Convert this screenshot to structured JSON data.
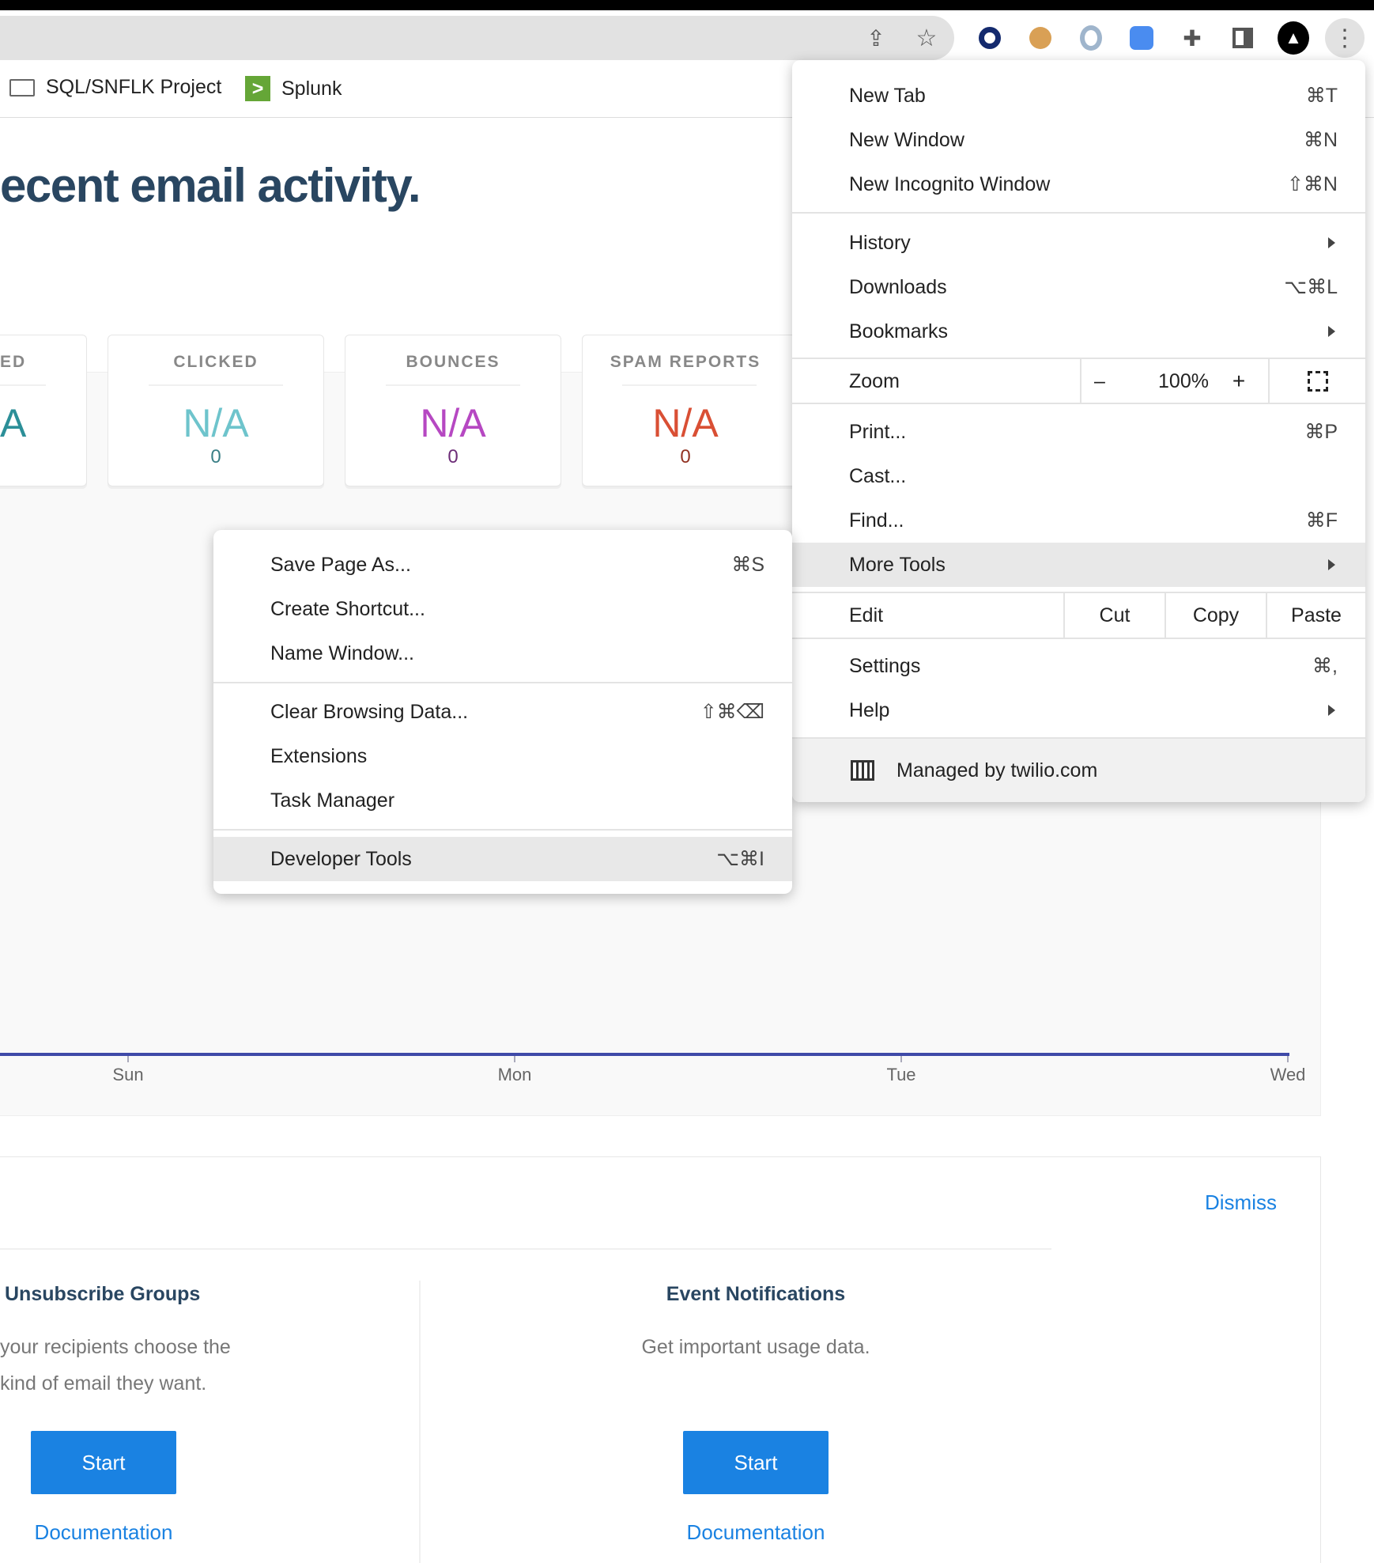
{
  "browser": {
    "toolbar_icons": [
      "share-icon",
      "bookmark-star-icon",
      "extension-o-icon",
      "cookie-extension-icon",
      "extension-ring-icon",
      "zoom-extension-icon",
      "extensions-puzzle-icon",
      "side-panel-icon",
      "profile-rocket-icon",
      "kebab-menu-icon"
    ],
    "bookmarks": [
      {
        "label": "SQL/SNFLK Project",
        "icon": "folder-icon"
      },
      {
        "label": "Splunk",
        "icon": "splunk-icon"
      }
    ]
  },
  "page": {
    "title": "ecent email activity.",
    "cards": [
      {
        "label": "ED",
        "value": "A",
        "count": "",
        "color": "#2c8f98"
      },
      {
        "label": "CLICKED",
        "value": "N/A",
        "count": "0",
        "color": "#6ec4cc",
        "count_color": "#3a7f86"
      },
      {
        "label": "BOUNCES",
        "value": "N/A",
        "count": "0",
        "color": "#b648c2",
        "count_color": "#6d2d78"
      },
      {
        "label": "SPAM REPORTS",
        "value": "N/A",
        "count": "0",
        "color": "#d94f34",
        "count_color": "#923222"
      }
    ],
    "chart": {
      "x_labels": [
        "Sun",
        "Mon",
        "Tue",
        "Wed"
      ],
      "line_color": "#3f4aa8"
    },
    "bottom": {
      "dismiss": "Dismiss",
      "sections": [
        {
          "title": "Unsubscribe Groups",
          "desc1": "your recipients choose the",
          "desc2": "kind of email they want.",
          "button": "Start",
          "link": "Documentation"
        },
        {
          "title": "Event Notifications",
          "desc1": "Get important usage data.",
          "button": "Start",
          "link": "Documentation"
        }
      ]
    }
  },
  "menu": {
    "new_tab": {
      "label": "New Tab",
      "shortcut": "⌘T"
    },
    "new_window": {
      "label": "New Window",
      "shortcut": "⌘N"
    },
    "incognito": {
      "label": "New Incognito Window",
      "shortcut": "⇧⌘N"
    },
    "history": {
      "label": "History"
    },
    "downloads": {
      "label": "Downloads",
      "shortcut": "⌥⌘L"
    },
    "bookmarks": {
      "label": "Bookmarks"
    },
    "zoom": {
      "label": "Zoom",
      "minus": "–",
      "value": "100%",
      "plus": "+"
    },
    "print": {
      "label": "Print...",
      "shortcut": "⌘P"
    },
    "cast": {
      "label": "Cast..."
    },
    "find": {
      "label": "Find...",
      "shortcut": "⌘F"
    },
    "more_tools": {
      "label": "More Tools"
    },
    "edit": {
      "label": "Edit",
      "cut": "Cut",
      "copy": "Copy",
      "paste": "Paste"
    },
    "settings": {
      "label": "Settings",
      "shortcut": "⌘,"
    },
    "help": {
      "label": "Help"
    },
    "managed": {
      "label": "Managed by twilio.com"
    }
  },
  "submenu": {
    "save_page": {
      "label": "Save Page As...",
      "shortcut": "⌘S"
    },
    "create_shortcut": {
      "label": "Create Shortcut..."
    },
    "name_window": {
      "label": "Name Window..."
    },
    "clear_data": {
      "label": "Clear Browsing Data...",
      "shortcut": "⇧⌘⌫"
    },
    "extensions": {
      "label": "Extensions"
    },
    "task_manager": {
      "label": "Task Manager"
    },
    "dev_tools": {
      "label": "Developer Tools",
      "shortcut": "⌥⌘I"
    }
  }
}
